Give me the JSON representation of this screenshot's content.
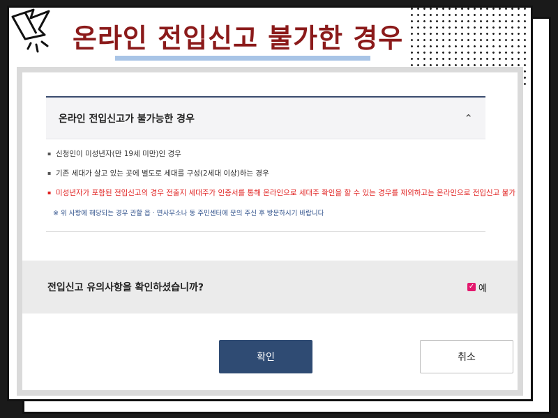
{
  "banner": {
    "title": "온라인 전입신고 불가한 경우"
  },
  "accordion": {
    "header": "온라인 전입신고가 불가능한 경우",
    "chevron_icon": "chevron-up-icon",
    "items": [
      {
        "text": "신청인이 미성년자(만 19세 미만)인 경우",
        "color": "#333333"
      },
      {
        "text": "기존 세대가 살고 있는 곳에 별도로 세대를 구성(2세대 이상)하는 경우",
        "color": "#333333"
      },
      {
        "text": "미성년자가 포함된 전입신고의 경우 전출지 세대주가 인증서를 통해 온라인으로 세대주 확인을 할 수 있는 경우를 제외하고는 온라인으로 전입신고 불가",
        "color": "#e0201f"
      }
    ],
    "note": "※ 위 사항에 해당되는 경우 관할 읍 · 면사무소나 동 주민센터에 문의 주신 후 방문하시기 바랍니다"
  },
  "confirm": {
    "question": "전입신고 유의사항을 확인하셨습니까?",
    "checkbox_label": "예",
    "checked": true
  },
  "buttons": {
    "ok": "확인",
    "cancel": "취소"
  },
  "colors": {
    "title": "#8b1a1a",
    "primary_button": "#2f4b73",
    "checkbox": "#e3186e",
    "warning_text": "#e0201f",
    "note_text": "#2d4f8a"
  }
}
